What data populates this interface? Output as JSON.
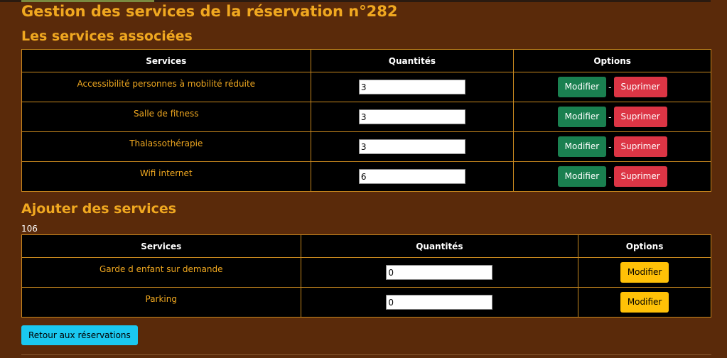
{
  "title": "Gestion des services de la réservation n°282",
  "associated": {
    "heading": "Les services associées",
    "headers": [
      "Services",
      "Quantités",
      "Options"
    ],
    "rows": [
      {
        "service": "Accessibilité personnes à mobilité réduite",
        "qty": "3"
      },
      {
        "service": "Salle de fitness",
        "qty": "3"
      },
      {
        "service": "Thalassothérapie",
        "qty": "3"
      },
      {
        "service": "Wifi internet",
        "qty": "6"
      }
    ],
    "modify_label": "Modifier",
    "separator": "-",
    "delete_label": "Suprimer"
  },
  "add": {
    "heading": "Ajouter des services",
    "count": "106",
    "headers": [
      "Services",
      "Quantités",
      "Options"
    ],
    "rows": [
      {
        "service": "Garde d enfant sur demande",
        "qty": "0"
      },
      {
        "service": "Parking",
        "qty": "0"
      }
    ],
    "modify_label": "Modifier"
  },
  "back_label": "Retour aux réservations",
  "colors": {
    "background": "#5a2a0a",
    "accent": "#f0a820",
    "green": "#1a8050",
    "red": "#dc3545",
    "yellow": "#ffc107",
    "cyan": "#1ac8f0"
  }
}
